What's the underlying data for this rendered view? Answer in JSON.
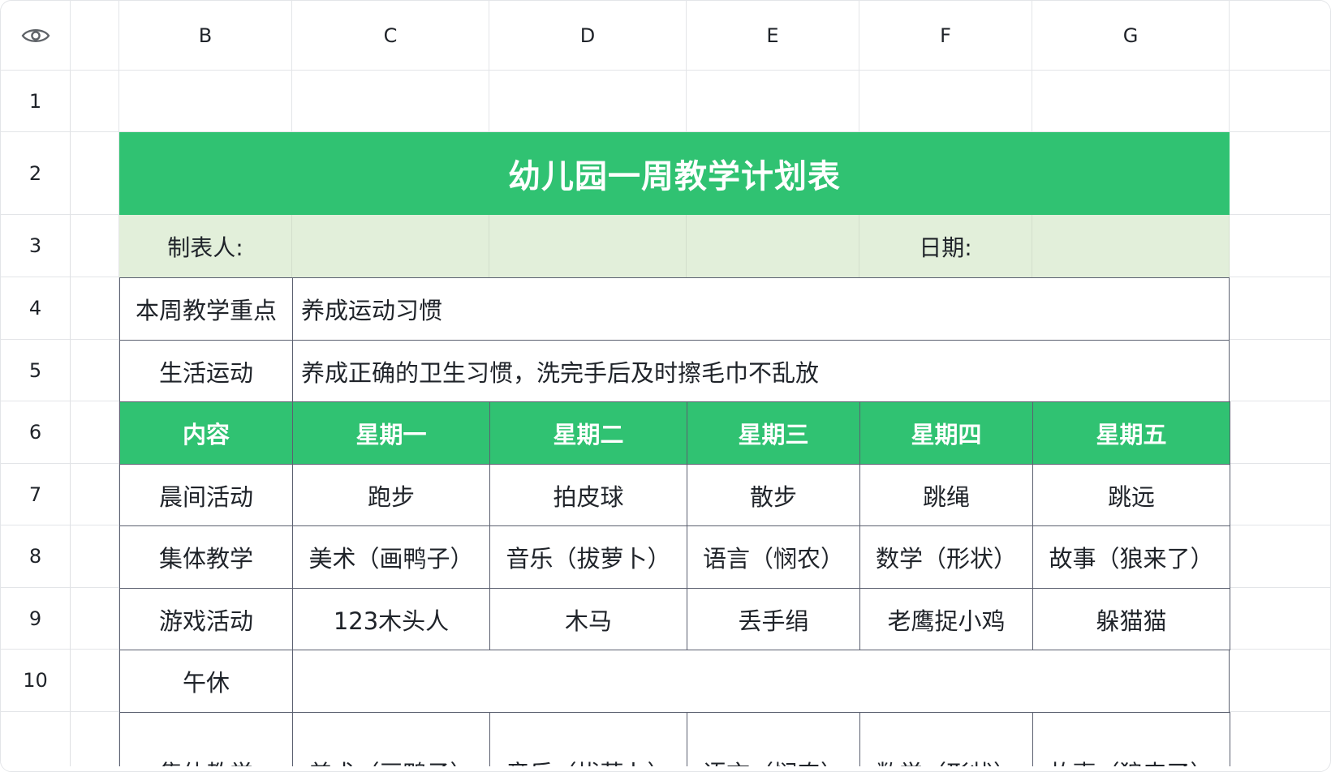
{
  "column_headers": [
    "B",
    "C",
    "D",
    "E",
    "F",
    "G"
  ],
  "row_numbers": [
    "1",
    "2",
    "3",
    "4",
    "5",
    "6",
    "7",
    "8",
    "9",
    "10"
  ],
  "icons": {
    "visibility": "eye-icon"
  },
  "colors": {
    "header_green": "#30c272",
    "subheader_green": "#e2efda",
    "border": "#5b6070"
  },
  "sheet": {
    "title": "幼儿园一周教学计划表",
    "maker_label": "制表人:",
    "date_label": "日期:",
    "focus_label": "本周教学重点",
    "focus_value": "养成运动习惯",
    "life_label": "生活运动",
    "life_value": "养成正确的卫生习惯，洗完手后及时擦毛巾不乱放",
    "header": [
      "内容",
      "星期一",
      "星期二",
      "星期三",
      "星期四",
      "星期五"
    ],
    "rows": [
      [
        "晨间活动",
        "跑步",
        "拍皮球",
        "散步",
        "跳绳",
        "跳远"
      ],
      [
        "集体教学",
        "美术（画鸭子）",
        "音乐（拔萝卜）",
        "语言（悯农）",
        "数学（形状）",
        "故事（狼来了）"
      ],
      [
        "游戏活动",
        "123木头人",
        "木马",
        "丢手绢",
        "老鹰捉小鸡",
        "躲猫猫"
      ]
    ],
    "nap_label": "午休",
    "partial_row": [
      "集体教学",
      "美术（画鸭子）",
      "音乐（拔萝卜）",
      "语言（悯农）",
      "数学（形状）",
      "故事（狼来了）"
    ]
  }
}
